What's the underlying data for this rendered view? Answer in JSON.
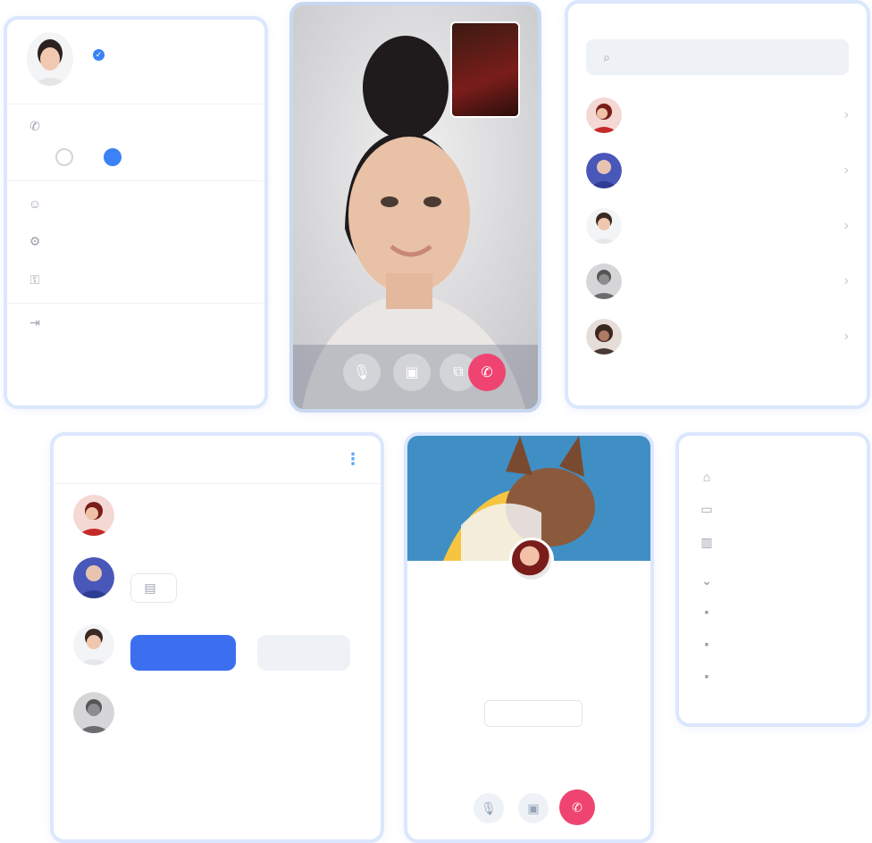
{
  "profile_menu": {
    "user_name": "",
    "user_subtitle": "",
    "availability": {
      "title": "",
      "options": [
        "",
        ""
      ],
      "selected_index": 1
    },
    "items": [
      {
        "icon": "user-icon",
        "label": ""
      },
      {
        "icon": "gear-icon",
        "label": ""
      },
      {
        "icon": "key-icon",
        "label": ""
      }
    ],
    "logout": {
      "icon": "logout-icon",
      "label": ""
    }
  },
  "video_call": {
    "controls": [
      {
        "icon": "microphone-icon"
      },
      {
        "icon": "camera-icon"
      },
      {
        "icon": "screen-share-icon"
      }
    ],
    "end_call_icon": "end-call-icon",
    "colors": {
      "end_call": "#ef4471"
    }
  },
  "contacts": {
    "title": "",
    "search_placeholder": "",
    "items": [
      {
        "name": "",
        "subtitle": ""
      },
      {
        "name": "",
        "subtitle": ""
      },
      {
        "name": "",
        "subtitle": ""
      },
      {
        "name": "",
        "subtitle": ""
      },
      {
        "name": "",
        "subtitle": ""
      }
    ]
  },
  "notifications": {
    "title": "",
    "mark_all_label": "",
    "items": [
      {
        "actor": "",
        "text": "",
        "time": ""
      },
      {
        "actor": "",
        "text": "",
        "time": "",
        "attachment": ""
      },
      {
        "actor": "",
        "text": "",
        "time": "",
        "accept_label": "",
        "decline_label": ""
      },
      {
        "actor": "",
        "text": "",
        "time": ""
      }
    ],
    "colors": {
      "primary": "#3b6ff0"
    }
  },
  "profile_card": {
    "handle": "",
    "name": "",
    "follow_label": "",
    "cover_color": "#3f8fc4",
    "controls": [
      {
        "icon": "microphone-icon"
      },
      {
        "icon": "camera-icon"
      }
    ],
    "end_call_icon": "end-call-icon"
  },
  "nav_menu": {
    "heading": "",
    "items": [
      {
        "icon": "home-icon",
        "label": ""
      },
      {
        "icon": "folder-icon",
        "label": ""
      },
      {
        "icon": "chart-icon",
        "label": ""
      }
    ],
    "section_title": "",
    "section_items": [
      {
        "icon": "dot-icon",
        "label": ""
      },
      {
        "icon": "dot-icon",
        "label": ""
      },
      {
        "icon": "dot-icon",
        "label": ""
      }
    ]
  }
}
